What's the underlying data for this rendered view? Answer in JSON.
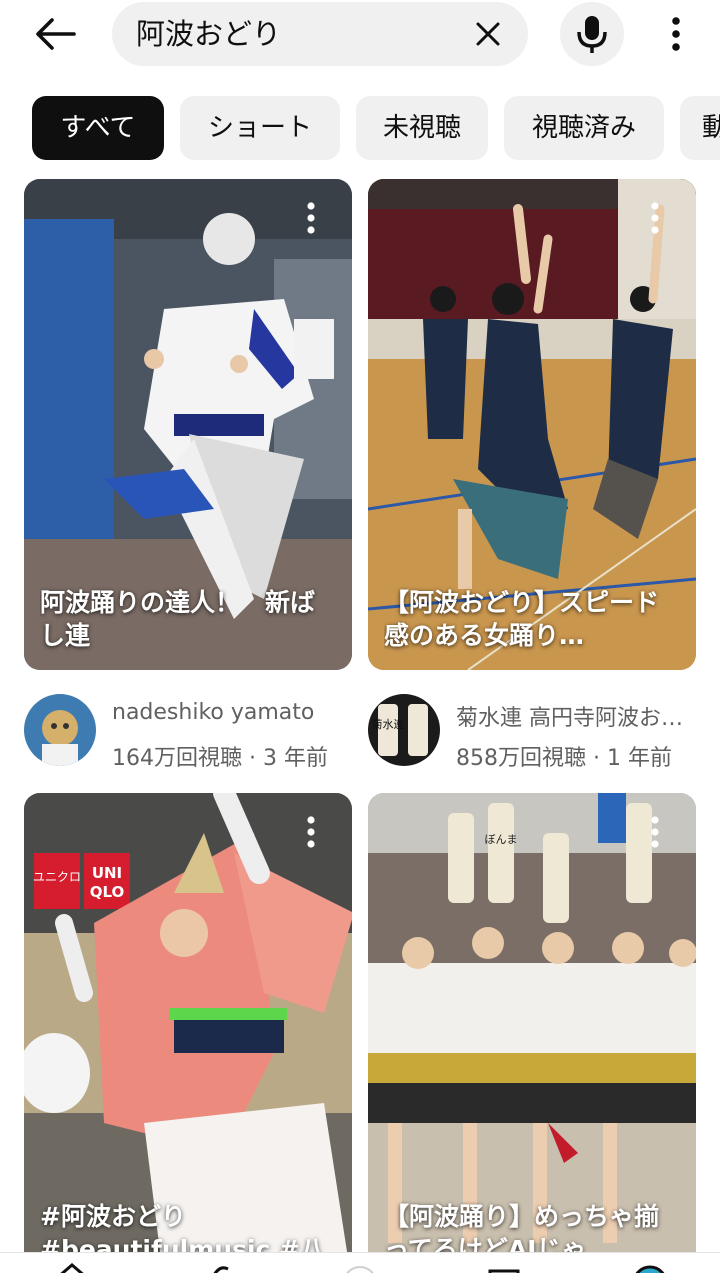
{
  "search": {
    "query": "阿波おどり"
  },
  "icons": {
    "back": "arrow-left-icon",
    "clear": "close-icon",
    "mic": "microphone-icon",
    "more": "more-vertical-icon"
  },
  "colors": {
    "chip_active_bg": "#0f0f0f",
    "chip_bg": "#f0f0f0",
    "secondary_text": "#606060"
  },
  "chips": [
    {
      "label": "すべて",
      "active": true
    },
    {
      "label": "ショート",
      "active": false
    },
    {
      "label": "未視聴",
      "active": false
    },
    {
      "label": "視聴済み",
      "active": false
    },
    {
      "label": "動",
      "active": false
    }
  ],
  "videos": [
    {
      "title": "阿波踊りの達人！　新ばし連",
      "channel": "nadeshiko yamato",
      "stats": "164万回視聴 · 3 年前"
    },
    {
      "title": "【阿波おどり】スピード感のある女踊り…",
      "channel": "菊水連 高円寺阿波お…",
      "stats": "858万回視聴 · 1 年前",
      "avatar_text": "菊水連"
    },
    {
      "title": "#阿波おどり #beautifulmusic #八"
    },
    {
      "title": "【阿波踊り】めっちゃ揃ってるけどAIじゃ"
    }
  ],
  "thumb_signs": {
    "uniqlo_katakana": "ユニクロ",
    "uniqlo_top": "UNI",
    "uniqlo_bottom": "QLO",
    "lantern": "ぼんま"
  }
}
